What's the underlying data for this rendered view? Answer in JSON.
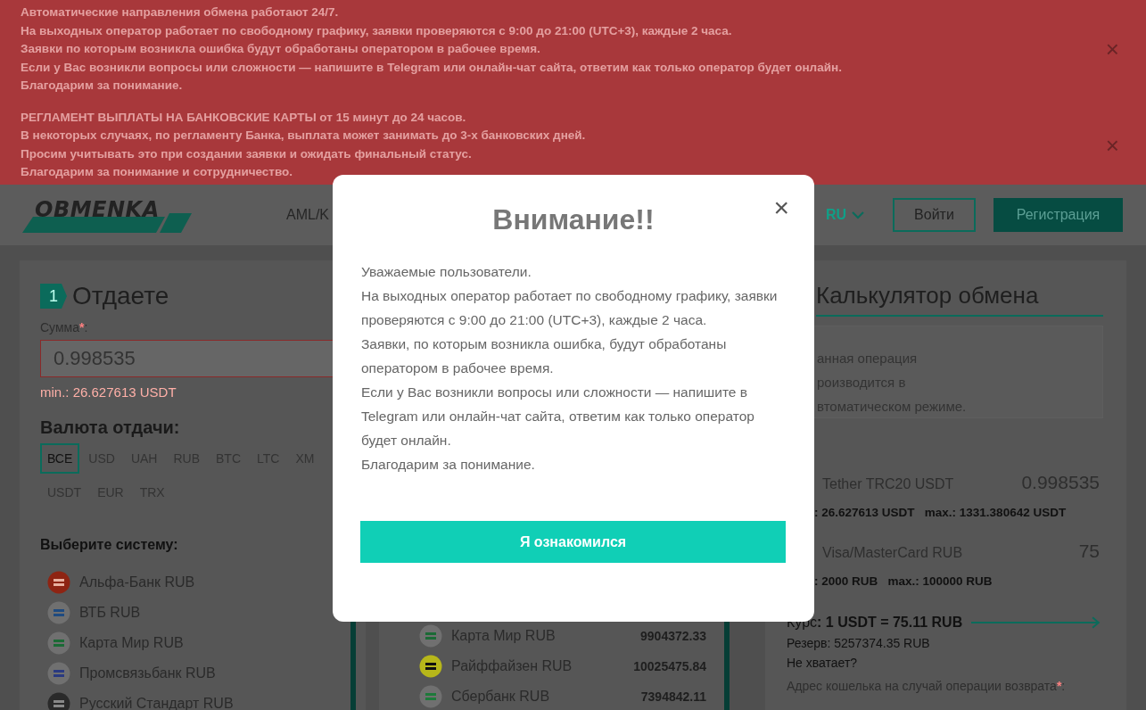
{
  "notices": [
    {
      "lines": [
        "Автоматические направления обмена работают 24/7.",
        "На выходных оператор работает по свободному графику, заявки проверяются с 9:00 до 21:00 (UTC+3), каждые 2 часа.",
        "Заявки по которым возникла ошибка будут обработаны оператором в рабочее время.",
        "Если у Вас возникли вопросы или сложности — напишите в Telegram или онлайн-чат сайта, ответим как только оператор будет онлайн.",
        "Благодарим за понимание."
      ],
      "close": "×"
    },
    {
      "lines": [
        "РЕГЛАМЕНТ ВЫПЛАТЫ НА БАНКОВСКИЕ КАРТЫ от 15 минут до 24 часов.",
        "В некоторых случаях, по регламенту Банка, выплата может занимать до 3-х банковских дней.",
        "Просим учитывать это при создании заявки и ожидать финальный статус.",
        "Благодарим за понимание и сотрудничество."
      ],
      "close": "×"
    }
  ],
  "header": {
    "logo": "OBMENKA",
    "nav": [
      "AML/K"
    ],
    "language": "RU",
    "login": "Войти",
    "register": "Регистрация"
  },
  "give": {
    "step": "1",
    "title": "Отдаете",
    "amount_label": "Сумма",
    "required_mark": "*",
    "colon": ":",
    "amount": "0.998535",
    "min_note": "min.: 26.627613 USDT",
    "currency_heading": "Валюта отдачи:",
    "currencies": [
      {
        "label": "ВСЕ",
        "selected": true
      },
      {
        "label": "USD",
        "selected": false
      },
      {
        "label": "UAH",
        "selected": false
      },
      {
        "label": "RUB",
        "selected": false
      },
      {
        "label": "BTC",
        "selected": false
      },
      {
        "label": "LTC",
        "selected": false
      },
      {
        "label": "XM",
        "selected": false
      },
      {
        "label": "USDT",
        "selected": false
      },
      {
        "label": "EUR",
        "selected": false
      },
      {
        "label": "TRX",
        "selected": false
      }
    ],
    "system_heading": "Выберите систему:",
    "systems": [
      {
        "name": "Альфа-Банк RUB",
        "kind": "alfa"
      },
      {
        "name": "ВТБ RUB",
        "kind": "vtb"
      },
      {
        "name": "Карта Мир RUB",
        "kind": "mir"
      },
      {
        "name": "Промсвязьбанк RUB",
        "kind": "psb"
      },
      {
        "name": "Русский Стандарт RUB",
        "kind": "rs"
      }
    ]
  },
  "get": {
    "systems": [
      {
        "name": "Карта Мир RUB",
        "kind": "mir",
        "reserve": "9904372.33"
      },
      {
        "name": "Райффайзен RUB",
        "kind": "raif",
        "reserve": "10025475.84"
      },
      {
        "name": "Сбербанк RUB",
        "kind": "sber",
        "reserve": "7394842.11"
      }
    ]
  },
  "calculator": {
    "title": "Калькулятор обмена",
    "info": [
      "анная операция",
      "роизводится в",
      "втоматическом режиме."
    ],
    "rows": [
      {
        "name": "Tether TRC20 USDT",
        "value": "0.998535",
        "limits": ": 26.627613 USDT   max.: 1331.380642 USDT"
      },
      {
        "name": "Visa/MasterCard RUB",
        "value": "75",
        "limits": ": 2000 RUB   max.: 100000 RUB"
      }
    ],
    "rate_label": "Курс",
    "rate": ": 1 USDT = 75.11 RUB",
    "reserve": "Резерв: 5257374.35 RUB",
    "not_enough": "Не хватает?",
    "refund_label": "Адрес кошелька на случай операции возврата",
    "refund_mark": "*",
    "refund_colon": ":"
  },
  "modal": {
    "title": "Внимание!!",
    "close": "×",
    "paragraphs": [
      "Уважаемые пользователи.",
      "На выходных оператор работает по свободному графику, заявки проверяются с 9:00 до 21:00 (UTC+3), каждые 2 часа.",
      "Заявки, по которым возникла ошибка, будут обработаны оператором в рабочее время.",
      "Если у Вас возникли вопросы или сложности — напишите в Telegram или онлайн-чат сайта, ответим как только оператор будет онлайн.",
      "Благодарим за понимание."
    ],
    "button": "Я ознакомился"
  }
}
